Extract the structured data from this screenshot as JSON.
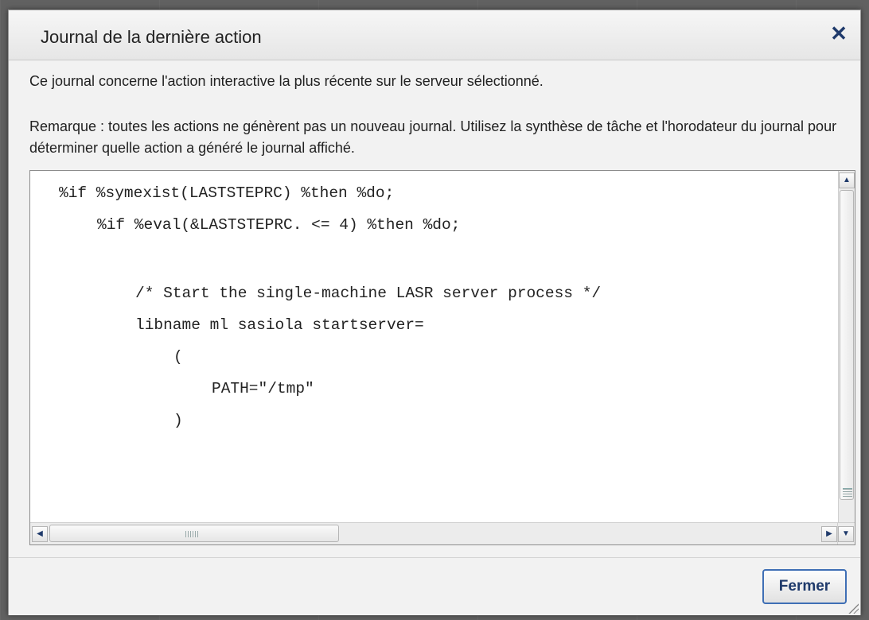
{
  "dialog": {
    "title": "Journal de la dernière action",
    "close_glyph": "✕",
    "intro": "Ce journal concerne l'action interactive la plus récente sur le serveur sélectionné.",
    "note": "Remarque : toutes les actions ne génèrent pas un nouveau journal. Utilisez la synthèse de tâche et l'horodateur du journal pour déterminer quelle action a généré le journal affiché.",
    "close_button_label": "Fermer"
  },
  "log": {
    "lines": [
      "%if %symexist(LASTSTEPRC) %then %do;",
      "%if %eval(&LASTSTEPRC. <= 4) %then %do;",
      "",
      "/* Start the single-machine LASR server process */",
      "libname ml sasiola startserver=",
      "(",
      "PATH=\"/tmp\"",
      ")"
    ]
  },
  "icons": {
    "close": "close-icon",
    "scroll_up": "arrow-up-icon",
    "scroll_down": "arrow-down-icon",
    "scroll_left": "arrow-left-icon",
    "scroll_right": "arrow-right-icon",
    "resize": "resize-grip-icon"
  },
  "colors": {
    "accent": "#3f6fb5",
    "icon": "#1f3a6b"
  }
}
